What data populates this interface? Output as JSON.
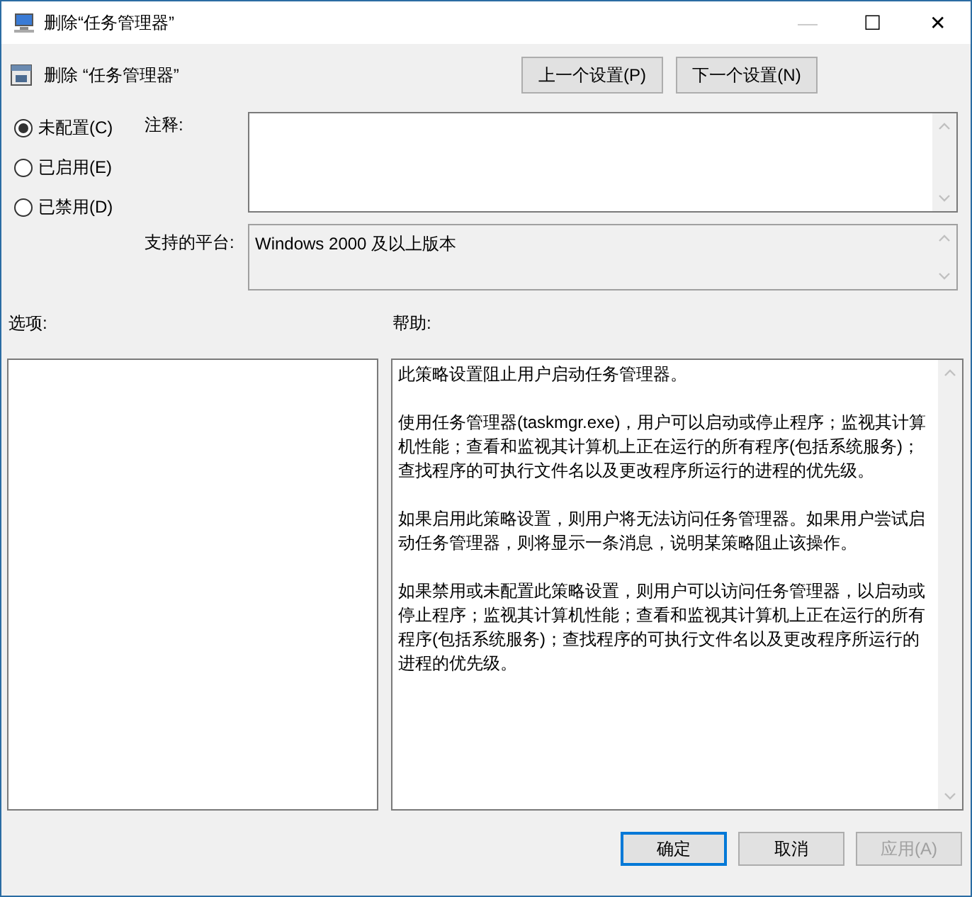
{
  "window": {
    "title": "删除“任务管理器”",
    "controls": [
      "—",
      "☐",
      "✕"
    ]
  },
  "header": {
    "title": "删除 “任务管理器”",
    "buttons": [
      {
        "label": "上一个设置(P)"
      },
      {
        "label": "下一个设置(N)"
      }
    ]
  },
  "state_options": [
    {
      "label": "未配置(C)",
      "selected": true
    },
    {
      "label": "已启用(E)",
      "selected": false
    },
    {
      "label": "已禁用(D)",
      "selected": false
    }
  ],
  "comment": {
    "label": "注释:"
  },
  "platform": {
    "label": "支持的平台:",
    "value": "Windows 2000 及以上版本"
  },
  "options": {
    "label": "选项:"
  },
  "help": {
    "label": "帮助:",
    "paragraphs": [
      "此策略设置阻止用户启动任务管理器。",
      "使用任务管理器(taskmgr.exe)，用户可以启动或停止程序；监视其计算机性能；查看和监视其计算机上正在运行的所有程序(包括系统服务)；查找程序的可执行文件名以及更改程序所运行的进程的优先级。",
      "如果启用此策略设置，则用户将无法访问任务管理器。如果用户尝试启动任务管理器，则将显示一条消息，说明某策略阻止该操作。",
      "如果禁用或未配置此策略设置，则用户可以访问任务管理器，以启动或停止程序；监视其计算机性能；查看和监视其计算机上正在运行的所有程序(包括系统服务)；查找程序的可执行文件名以及更改程序所运行的进程的优先级。"
    ]
  },
  "footer": {
    "buttons": [
      {
        "label": "确定",
        "default": true,
        "disabled": false
      },
      {
        "label": "取消",
        "default": false,
        "disabled": false
      },
      {
        "label": "应用(A)",
        "default": false,
        "disabled": true
      }
    ]
  }
}
